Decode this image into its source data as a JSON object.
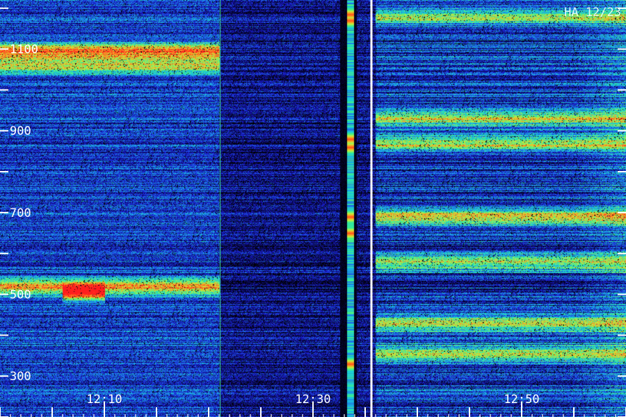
{
  "chart_data": {
    "type": "heatmap",
    "title": "HA 12/23",
    "x": {
      "tick_labels": [
        "12:10",
        "12:30",
        "12:50"
      ],
      "tick_minutes": [
        10,
        30,
        50
      ],
      "range_minutes": [
        0,
        60
      ]
    },
    "y": {
      "tick_labels": [
        "1100",
        "900",
        "700",
        "500",
        "300"
      ],
      "tick_values": [
        1100,
        900,
        700,
        500,
        300
      ],
      "range": [
        200,
        1220
      ]
    },
    "colormap": [
      "#000000",
      "#0a0a5a",
      "#1a1ad0",
      "#1f6fe6",
      "#18c8e0",
      "#3cf08c",
      "#c8f03c",
      "#ff8c1e",
      "#ff1e1e"
    ],
    "intensity_range": [
      0,
      1
    ],
    "data_gap_minutes": [
      32.6,
      34.2
    ],
    "marker_minute": 35.6,
    "vertical_line_minute": 21.1,
    "bright_bands_mhz": [
      {
        "center": 1095,
        "intensity": 0.78,
        "from_minute": 0,
        "to_minute": 21
      },
      {
        "center": 1060,
        "intensity": 0.62,
        "from_minute": 0,
        "to_minute": 21
      },
      {
        "center": 520,
        "intensity": 0.75,
        "from_minute": 0,
        "to_minute": 21
      },
      {
        "center": 505,
        "intensity": 0.8,
        "from_minute": 6,
        "to_minute": 10
      },
      {
        "center": 1180,
        "intensity": 0.55,
        "from_minute": 36,
        "to_minute": 60
      },
      {
        "center": 930,
        "intensity": 0.6,
        "from_minute": 36,
        "to_minute": 60
      },
      {
        "center": 870,
        "intensity": 0.62,
        "from_minute": 36,
        "to_minute": 60
      },
      {
        "center": 690,
        "intensity": 0.66,
        "from_minute": 36,
        "to_minute": 60
      },
      {
        "center": 580,
        "intensity": 0.6,
        "from_minute": 36,
        "to_minute": 60
      },
      {
        "center": 430,
        "intensity": 0.62,
        "from_minute": 36,
        "to_minute": 60
      },
      {
        "center": 355,
        "intensity": 0.58,
        "from_minute": 36,
        "to_minute": 60
      }
    ],
    "burst_spots_mhz": [
      1185,
      1170,
      880,
      860,
      690,
      650,
      330
    ]
  }
}
